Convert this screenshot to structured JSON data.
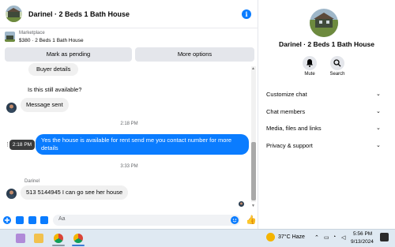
{
  "header": {
    "title": "Darinel · 2 Beds 1 Bath House",
    "info_icon": "info-icon"
  },
  "marketplace": {
    "label": "Marketplace",
    "listing": "$380 · 2 Beds 1 Bath House",
    "pending_button": "Mark as pending",
    "options_button": "More options"
  },
  "messages": [
    {
      "type": "in",
      "text": "Buyer details"
    },
    {
      "type": "in",
      "text": "Is this still available?"
    },
    {
      "type": "in",
      "text": "Message sent"
    },
    {
      "type": "time",
      "text": "2:18 PM"
    },
    {
      "type": "out",
      "text": "Yes the house is available for rent  send me you contact number for more details"
    },
    {
      "type": "time",
      "text": "3:33 PM"
    },
    {
      "type": "sender",
      "text": "Darinel"
    },
    {
      "type": "in",
      "text": "513 5144945  I can go see her house"
    }
  ],
  "tooltip": "2:18 PM",
  "composer": {
    "placeholder": "Aa"
  },
  "side_panel": {
    "title": "Darinel · 2 Beds 1 Bath House",
    "actions": [
      {
        "label": "Mute",
        "icon": "bell-icon"
      },
      {
        "label": "Search",
        "icon": "search-icon"
      }
    ],
    "menu": [
      "Customize chat",
      "Chat members",
      "Media, files and links",
      "Privacy & support"
    ]
  },
  "taskbar": {
    "weather": "37°C  Haze",
    "time": "5:56 PM",
    "date": "9/13/2024"
  },
  "colors": {
    "accent": "#0a7cff",
    "bubble_in": "#f0f0f0",
    "taskbar": "#dfe9f2"
  }
}
